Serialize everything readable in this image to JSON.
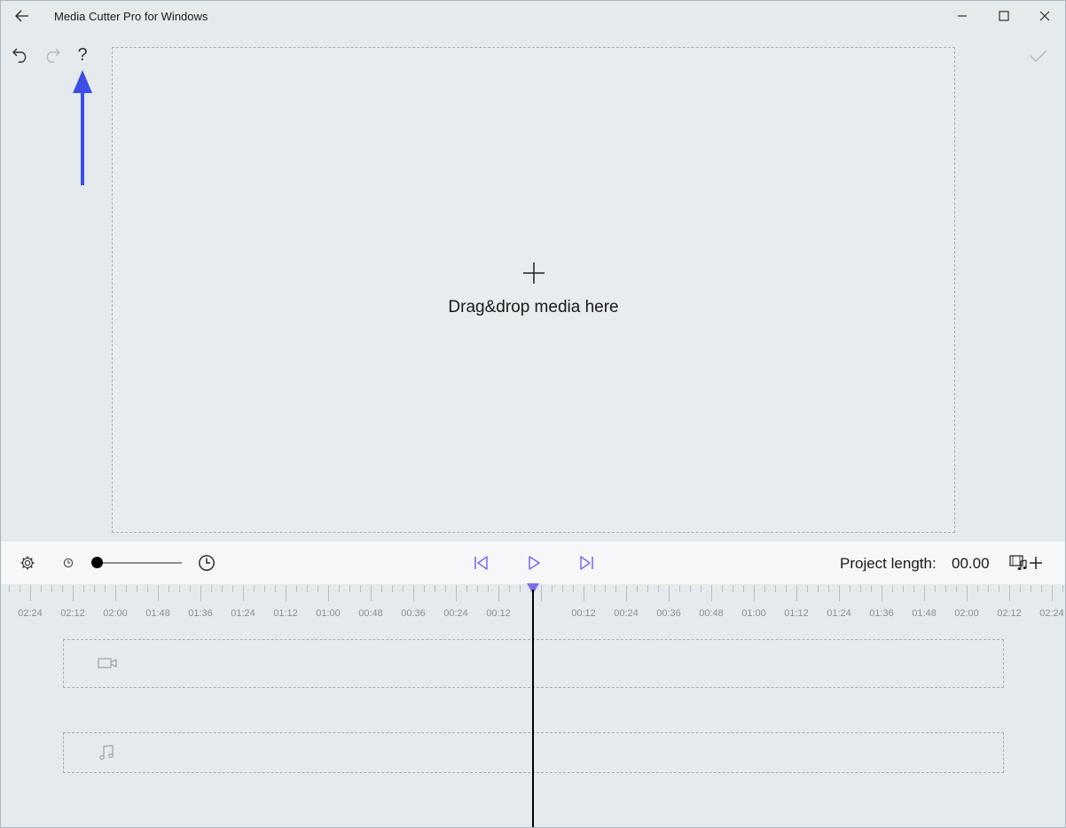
{
  "window": {
    "title": "Media Cutter Pro for Windows"
  },
  "dropzone": {
    "text": "Drag&drop media here"
  },
  "controls": {
    "project_length_label": "Project length:",
    "project_length_value": "00.00"
  },
  "timeline": {
    "labels": [
      "02:24",
      "02:12",
      "02:00",
      "01:48",
      "01:36",
      "01:24",
      "01:12",
      "01:00",
      "00:48",
      "00:36",
      "00:24",
      "00:12",
      "",
      "00:12",
      "00:24",
      "00:36",
      "00:48",
      "01:00",
      "01:12",
      "01:24",
      "01:36",
      "01:48",
      "02:00",
      "02:12",
      "02:24"
    ],
    "playhead": "00:00",
    "zoom_level": 0
  },
  "colors": {
    "accent": "#7b6cf0",
    "annotation_arrow": "#3d4ee6"
  },
  "icons": [
    "back-icon",
    "minimize-icon",
    "maximize-icon",
    "close-icon",
    "undo-icon",
    "redo-icon",
    "help-icon",
    "checkmark-icon",
    "plus-icon",
    "settings-icon",
    "small-clock-icon",
    "large-clock-icon",
    "skip-to-start-icon",
    "play-icon",
    "skip-to-end-icon",
    "add-media-icon",
    "video-camera-icon",
    "music-note-icon"
  ]
}
